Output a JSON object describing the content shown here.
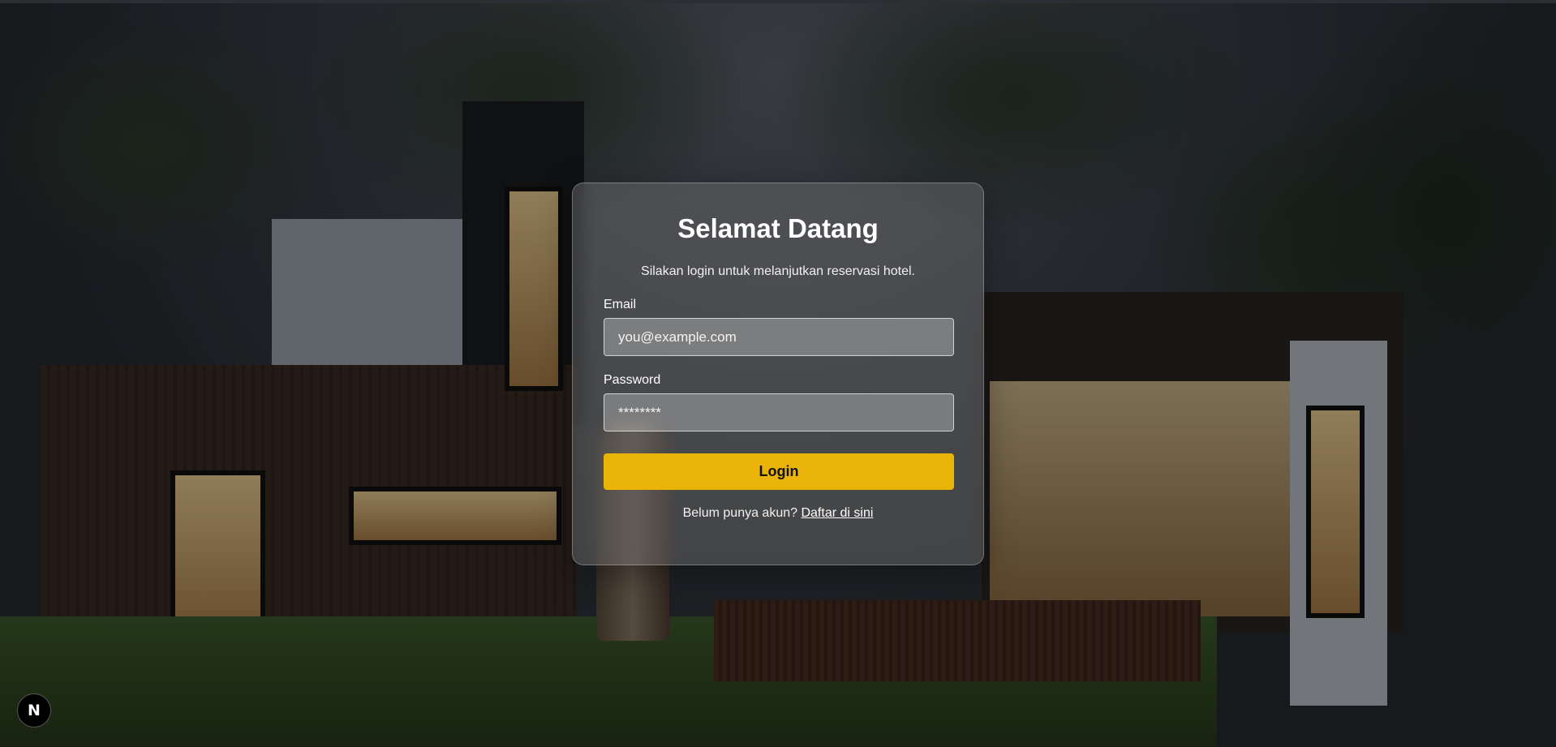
{
  "login": {
    "title": "Selamat Datang",
    "subtitle": "Silakan login untuk melanjutkan reservasi hotel.",
    "email_label": "Email",
    "email_placeholder": "you@example.com",
    "password_label": "Password",
    "password_placeholder": "********",
    "submit_label": "Login",
    "register_prompt": "Belum punya akun?",
    "register_link": "Daftar di sini"
  },
  "corner_badge": {
    "letter": "N",
    "icon": "nextjs-logo-icon"
  },
  "colors": {
    "accent": "#eab308",
    "card_background": "rgba(120,120,120,0.42)"
  }
}
